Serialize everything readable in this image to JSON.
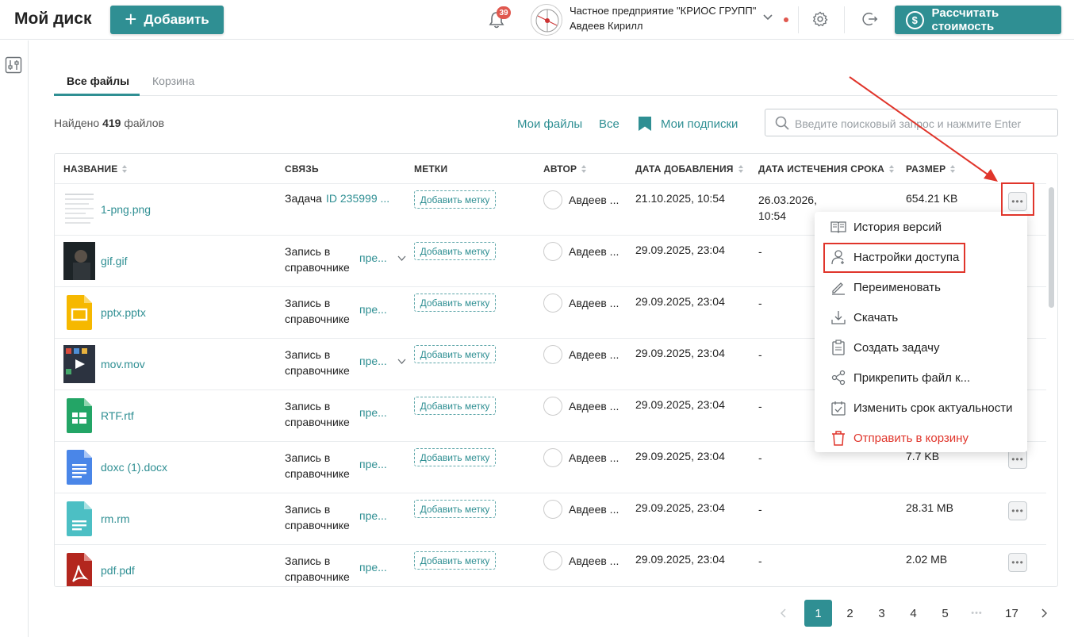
{
  "header": {
    "title": "Мой диск",
    "add_label": "Добавить",
    "notifications_count": "39",
    "org_name": "Частное предприятие \"КРИОС ГРУПП\"",
    "user_name": "Авдеев Кирилл",
    "calc_label": "Рассчитать стоимость",
    "accent_color": "#2f8f93"
  },
  "tabs": {
    "all": "Все файлы",
    "trash": "Корзина"
  },
  "toolbar": {
    "found_prefix": "Найдено",
    "found_count": "419",
    "found_suffix": "файлов",
    "my_files": "Мои файлы",
    "all": "Все",
    "subscriptions": "Мои подписки",
    "search_placeholder": "Введите поисковый запрос и нажмите Enter"
  },
  "table": {
    "columns": [
      "НАЗВАНИЕ",
      "СВЯЗЬ",
      "МЕТКИ",
      "АВТОР",
      "ДАТА ДОБАВЛЕНИЯ",
      "ДАТА ИСТЕЧЕНИЯ СРОКА",
      "РАЗМЕР"
    ],
    "add_tag_label": "Добавить метку",
    "rows": [
      {
        "name": "1-png.png",
        "icon": "png-thumbnail",
        "link_type": "Задача",
        "link_value": "ID 235999 ...",
        "author": "Авдеев ...",
        "added": "21.10.2025, 10:54",
        "expires_line1": "26.03.2026,",
        "expires_line2": "10:54",
        "size": "654.21 KB"
      },
      {
        "name": "gif.gif",
        "icon": "gif-thumbnail",
        "link_type": "Запись в справочнике",
        "link_value": "пре...",
        "author": "Авдеев ...",
        "added": "29.09.2025, 23:04",
        "expires_line1": "-",
        "expires_line2": "",
        "size": ""
      },
      {
        "name": "pptx.pptx",
        "icon": "slides-file-icon",
        "link_type": "Запись в справочнике",
        "link_value": "пре...",
        "author": "Авдеев ...",
        "added": "29.09.2025, 23:04",
        "expires_line1": "-",
        "expires_line2": "",
        "size": ""
      },
      {
        "name": "mov.mov",
        "icon": "video-thumbnail",
        "link_type": "Запись в справочнике",
        "link_value": "пре...",
        "author": "Авдеев ...",
        "added": "29.09.2025, 23:04",
        "expires_line1": "-",
        "expires_line2": "",
        "size": ""
      },
      {
        "name": "RTF.rtf",
        "icon": "sheets-file-icon",
        "link_type": "Запись в справочнике",
        "link_value": "пре...",
        "author": "Авдеев ...",
        "added": "29.09.2025, 23:04",
        "expires_line1": "-",
        "expires_line2": "",
        "size": ""
      },
      {
        "name": "doxc (1).docx",
        "icon": "docs-file-icon",
        "link_type": "Запись в справочнике",
        "link_value": "пре...",
        "author": "Авдеев ...",
        "added": "29.09.2025, 23:04",
        "expires_line1": "-",
        "expires_line2": "",
        "size": "7.7 KB"
      },
      {
        "name": "rm.rm",
        "icon": "media-file-icon",
        "link_type": "Запись в справочнике",
        "link_value": "пре...",
        "author": "Авдеев ...",
        "added": "29.09.2025, 23:04",
        "expires_line1": "-",
        "expires_line2": "",
        "size": "28.31 MB"
      },
      {
        "name": "pdf.pdf",
        "icon": "pdf-file-icon",
        "link_type": "Запись в справочнике",
        "link_value": "пре...",
        "author": "Авдеев ...",
        "added": "29.09.2025, 23:04",
        "expires_line1": "-",
        "expires_line2": "",
        "size": "2.02 MB"
      }
    ]
  },
  "context_menu": {
    "version_history": "История версий",
    "access_settings": "Настройки доступа",
    "rename": "Переименовать",
    "download": "Скачать",
    "create_task": "Создать задачу",
    "attach_file": "Прикрепить файл к...",
    "change_expiry": "Изменить срок актуальности",
    "send_to_trash": "Отправить в корзину",
    "danger_color": "#e0352b"
  },
  "pagination": {
    "pages": [
      "1",
      "2",
      "3",
      "4",
      "5",
      "17"
    ],
    "ellipsis": "•••",
    "current": "1"
  }
}
